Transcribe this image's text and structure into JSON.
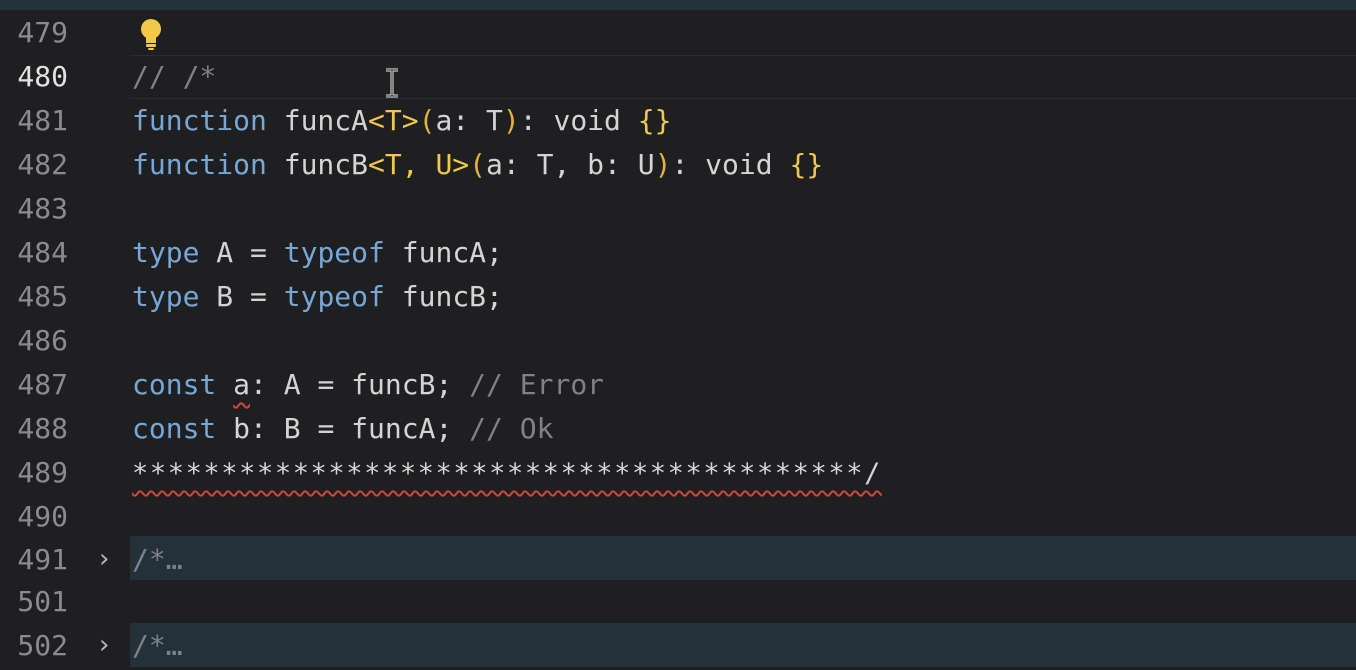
{
  "editor": {
    "lines": {
      "l479": {
        "num": "479"
      },
      "l480": {
        "num": "480",
        "t1": "// /*"
      },
      "l481": {
        "num": "481",
        "t1": "function",
        "t2": " funcA",
        "t3": "<T>",
        "t4": "(",
        "t5": "a: T",
        "t6": ")",
        "t7": ": void ",
        "t8": "{}"
      },
      "l482": {
        "num": "482",
        "t1": "function",
        "t2": " funcB",
        "t3": "<T, U>",
        "t4": "(",
        "t5": "a: T, b: U",
        "t6": ")",
        "t7": ": void ",
        "t8": "{}"
      },
      "l483": {
        "num": "483"
      },
      "l484": {
        "num": "484",
        "t1": "type",
        "t2": " A = ",
        "t3": "typeof",
        "t4": " funcA;"
      },
      "l485": {
        "num": "485",
        "t1": "type",
        "t2": " B = ",
        "t3": "typeof",
        "t4": " funcB;"
      },
      "l486": {
        "num": "486"
      },
      "l487": {
        "num": "487",
        "t1": "const",
        "t2": " ",
        "t3": "a",
        "t4": ": A = funcB; ",
        "t5": "// Error"
      },
      "l488": {
        "num": "488",
        "t1": "const",
        "t2": " b: B = funcA; ",
        "t3": "// Ok"
      },
      "l489": {
        "num": "489",
        "t1": "*****************************************/"
      },
      "l490": {
        "num": "490"
      },
      "l491": {
        "num": "491",
        "t1": "/*",
        "t2": "…"
      },
      "l501": {
        "num": "501"
      },
      "l502": {
        "num": "502",
        "t1": "/*",
        "t2": "…"
      }
    },
    "fold_chevron": "›",
    "colors": {
      "background": "#1f1f22",
      "keyword": "#76a7d6",
      "comment": "#7f8187",
      "bracket": "#f1c84b",
      "error_squiggle": "#d0463c",
      "folded_bg": "#24303a"
    }
  }
}
